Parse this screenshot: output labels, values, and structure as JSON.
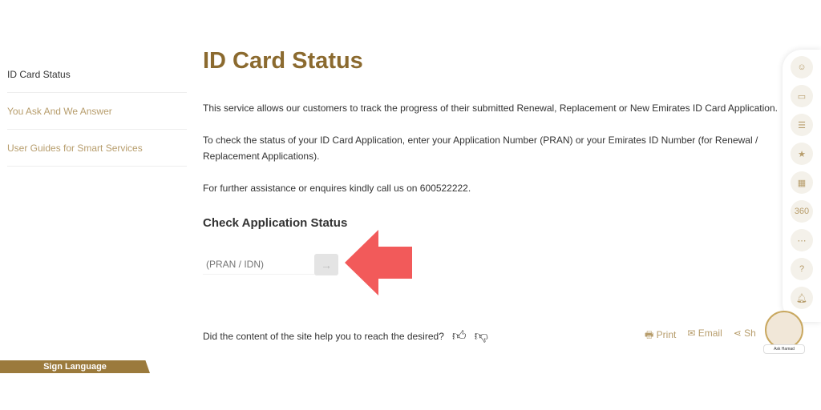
{
  "sidebar": {
    "items": [
      {
        "label": "ID Card Status",
        "active": true
      },
      {
        "label": "You Ask And We Answer"
      },
      {
        "label": "User Guides for Smart Services"
      }
    ],
    "sign_language": "Sign Language"
  },
  "main": {
    "title": "ID Card Status",
    "p1": "This service allows our customers to track the progress of their submitted Renewal, Replacement or New Emirates ID Card Application.",
    "p2": "To check the status of your ID Card Application, enter your Application Number (PRAN) or your Emirates ID Number (for Renewal / Replacement Applications).",
    "p3": "For further assistance or enquires kindly call us on 600522222.",
    "form_title": "Check Application Status",
    "input_placeholder": "(PRAN / IDN)"
  },
  "feedback": {
    "question": "Did the content of the site help you to reach the desired?"
  },
  "actions": {
    "print": "Print",
    "email": "Email",
    "share": "Sh"
  },
  "assistant": {
    "name": "Ask Hamad"
  },
  "colors": {
    "accent": "#8b6a2f",
    "arrow": "#f25a5a"
  },
  "rail_icons": [
    "avatar-icon",
    "card-icon",
    "list-icon",
    "rating-icon",
    "services-icon",
    "360-icon",
    "map-icon",
    "help-icon",
    "bell-icon"
  ]
}
